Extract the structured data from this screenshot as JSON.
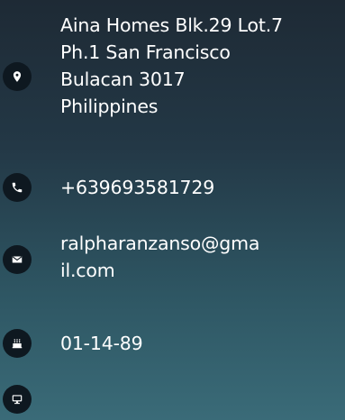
{
  "contact": {
    "address": {
      "icon": "map-marker-icon",
      "lines": [
        "Aina Homes Blk.29 Lot.7",
        "Ph.1 San Francisco",
        "Bulacan 3017",
        "Philippines"
      ]
    },
    "phone": {
      "icon": "phone-icon",
      "text": "+639693581729"
    },
    "email": {
      "icon": "envelope-icon",
      "lines": [
        "ralpharanzanso@gma",
        "il.com"
      ]
    },
    "birthday": {
      "icon": "birthday-cake-icon",
      "text": "01-14-89"
    },
    "website": {
      "icon": "desktop-icon"
    }
  },
  "colors": {
    "icon_background": "#0e1820",
    "text": "#ffffff",
    "gradient_top": "#1e2a35",
    "gradient_bottom": "#3a6b78"
  }
}
